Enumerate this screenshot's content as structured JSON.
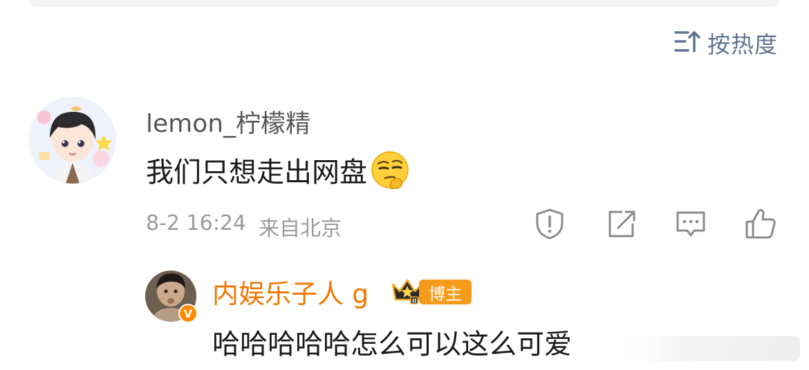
{
  "sort": {
    "label": "按热度",
    "icon": "sort-icon"
  },
  "comment": {
    "username": "lemon_柠檬精",
    "text": "我们只想走出网盘",
    "emoji": "thinking-face-emoji",
    "date": "8-2 16:24",
    "location": "来自北京",
    "actions": [
      "report-icon",
      "share-icon",
      "comment-icon",
      "like-icon"
    ]
  },
  "reply": {
    "username": "内娱乐子人 g",
    "badge": "博主",
    "text": "哈哈哈哈哈怎么可以这么可爱",
    "verified": "V"
  },
  "colors": {
    "accent_blue": "#5f7391",
    "reply_name": "#f07800",
    "badge_bg": "#f59b1b",
    "meta_gray": "#9b9b9b",
    "icon_gray": "#8a8a8a"
  }
}
